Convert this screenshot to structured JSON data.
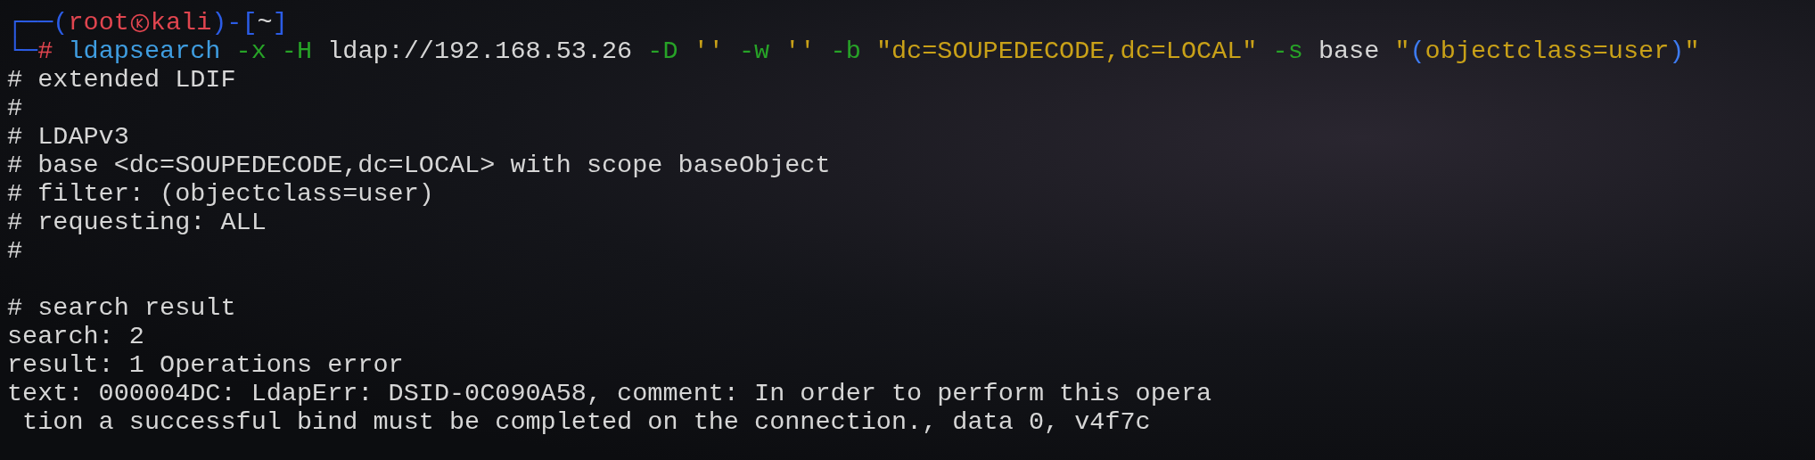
{
  "prompt": {
    "corner_top": "┌──",
    "open": "(",
    "user": "root",
    "host": "kali",
    "mid": ")-[",
    "dir": "~",
    "close": "]",
    "corner_bottom": "└─",
    "symbol": "#"
  },
  "command": [
    {
      "kind": "cmd",
      "text": "ldapsearch"
    },
    {
      "kind": "flag",
      "text": "-x"
    },
    {
      "kind": "flag",
      "text": "-H"
    },
    {
      "kind": "arg",
      "text": "ldap://192.168.53.26"
    },
    {
      "kind": "flag",
      "text": "-D"
    },
    {
      "kind": "string",
      "text": "''"
    },
    {
      "kind": "flag",
      "text": "-w"
    },
    {
      "kind": "string",
      "text": "''"
    },
    {
      "kind": "flag",
      "text": "-b"
    },
    {
      "kind": "string",
      "text": "\"dc=SOUPEDECODE,dc=LOCAL\""
    },
    {
      "kind": "flag",
      "text": "-s"
    },
    {
      "kind": "arg",
      "text": "base"
    },
    {
      "kind": "filter",
      "open": "\"(",
      "text": "objectclass=user",
      "close": ")\""
    }
  ],
  "output": [
    {
      "kind": "text",
      "text": "# extended LDIF"
    },
    {
      "kind": "text",
      "text": "#"
    },
    {
      "kind": "text",
      "text": "# LDAPv3"
    },
    {
      "kind": "text",
      "text": "# base <dc=SOUPEDECODE,dc=LOCAL> with scope baseObject"
    },
    {
      "kind": "text",
      "text": "# filter: (objectclass=user)"
    },
    {
      "kind": "text",
      "text": "# requesting: ALL"
    },
    {
      "kind": "text",
      "text": "#"
    },
    {
      "kind": "blank"
    },
    {
      "kind": "text",
      "text": "# search result"
    },
    {
      "kind": "text",
      "text": "search: 2"
    },
    {
      "kind": "text",
      "text": "result: 1 Operations error"
    },
    {
      "kind": "text",
      "text": "text: 000004DC: LdapErr: DSID-0C090A58, comment: In order to perform this opera"
    },
    {
      "kind": "text",
      "text": " tion a successful bind must be completed on the connection., data 0, v4f7c"
    }
  ]
}
